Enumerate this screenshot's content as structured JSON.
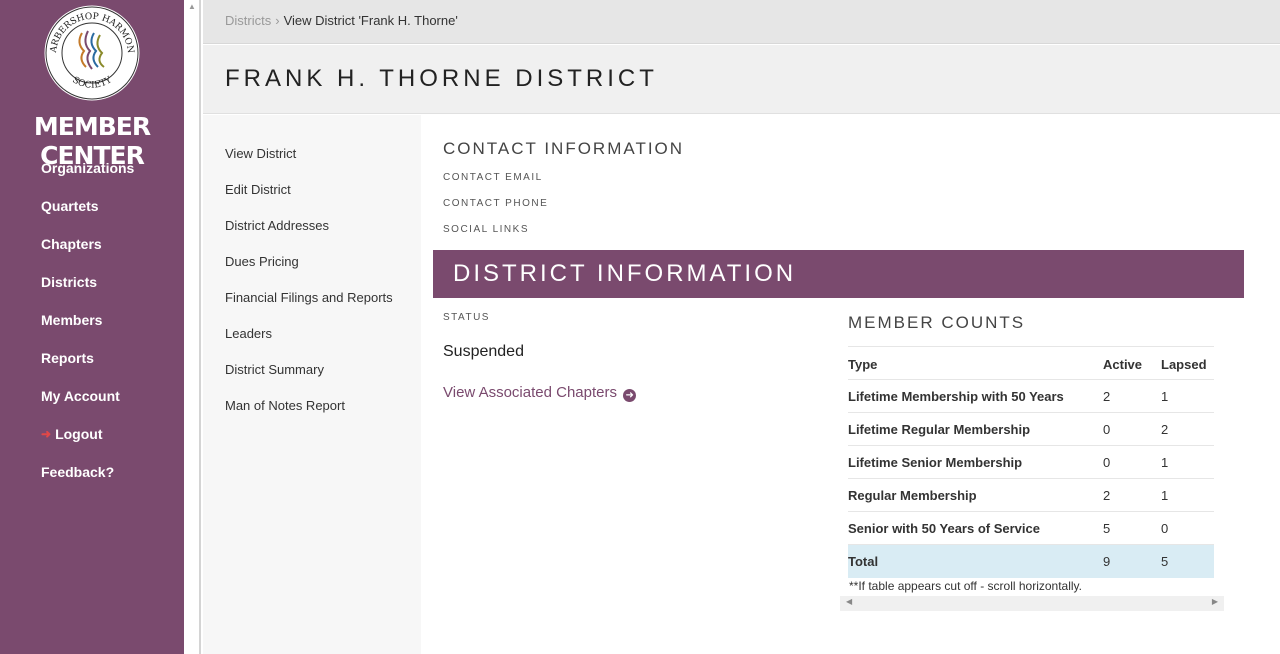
{
  "sidebar": {
    "logo_text_top": "BARBERSHOP HARMONY",
    "logo_text_bottom": "SOCIETY",
    "brand": "MEMBER CENTER",
    "items": [
      {
        "label": "Organizations"
      },
      {
        "label": "Quartets"
      },
      {
        "label": "Chapters"
      },
      {
        "label": "Districts"
      },
      {
        "label": "Members"
      },
      {
        "label": "Reports"
      },
      {
        "label": "My Account"
      },
      {
        "label": "Logout",
        "icon": "sign-out-icon"
      },
      {
        "label": "Feedback?"
      }
    ]
  },
  "breadcrumb": {
    "parent": "Districts",
    "separator": "›",
    "current": "View District 'Frank H. Thorne'"
  },
  "page_title": "FRANK H. THORNE DISTRICT",
  "subnav": [
    "View District",
    "Edit District",
    "District Addresses",
    "Dues Pricing",
    "Financial Filings and Reports",
    "Leaders",
    "District Summary",
    "Man of Notes Report"
  ],
  "contact": {
    "title": "CONTACT INFORMATION",
    "email_label": "CONTACT EMAIL",
    "phone_label": "CONTACT PHONE",
    "social_label": "SOCIAL LINKS"
  },
  "district_info": {
    "banner": "DISTRICT INFORMATION",
    "status_label": "STATUS",
    "status_value": "Suspended",
    "assoc_link": "View Associated Chapters"
  },
  "member_counts": {
    "title": "MEMBER COUNTS",
    "columns": [
      "Type",
      "Active",
      "Lapsed"
    ],
    "rows": [
      {
        "type": "Lifetime Membership with 50 Years",
        "active": "2",
        "lapsed": "1"
      },
      {
        "type": "Lifetime Regular Membership",
        "active": "0",
        "lapsed": "2"
      },
      {
        "type": "Lifetime Senior Membership",
        "active": "0",
        "lapsed": "1"
      },
      {
        "type": "Regular Membership",
        "active": "2",
        "lapsed": "1"
      },
      {
        "type": "Senior with 50 Years of Service",
        "active": "5",
        "lapsed": "0"
      }
    ],
    "total": {
      "type": "Total",
      "active": "9",
      "lapsed": "5"
    },
    "note": "**If table appears cut off - scroll horizontally."
  },
  "colors": {
    "brand_purple": "#7a4a6e",
    "total_row": "#d9ecf4",
    "logout_icon": "#e04848"
  }
}
